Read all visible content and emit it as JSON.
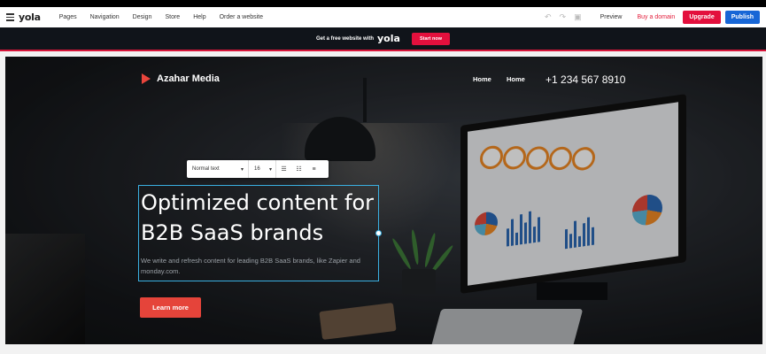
{
  "editor": {
    "logo": "yola",
    "menu": [
      "Pages",
      "Navigation",
      "Design",
      "Store",
      "Help",
      "Order a website"
    ],
    "preview_label": "Preview",
    "buy_domain_label": "Buy a domain",
    "upgrade_label": "Upgrade",
    "publish_label": "Publish"
  },
  "promo": {
    "text": "Get a free website with",
    "logo": "yola",
    "button": "Start now"
  },
  "site": {
    "brand": "Azahar Media",
    "nav": [
      "Home",
      "Home"
    ],
    "phone": "+1 234 567 8910",
    "headline_line1": "Optimized content for",
    "headline_line2": "B2B SaaS brands",
    "subtext": "We write and refresh content for leading B2B SaaS brands, like Zapier and monday.com.",
    "cta": "Learn more"
  },
  "text_toolbar": {
    "style": "Normal text",
    "size": "16"
  },
  "colors": {
    "brand_red": "#e3103d",
    "publish_blue": "#1766d6",
    "cta_red": "#e5443a",
    "selection_blue": "#3ab0e2"
  }
}
